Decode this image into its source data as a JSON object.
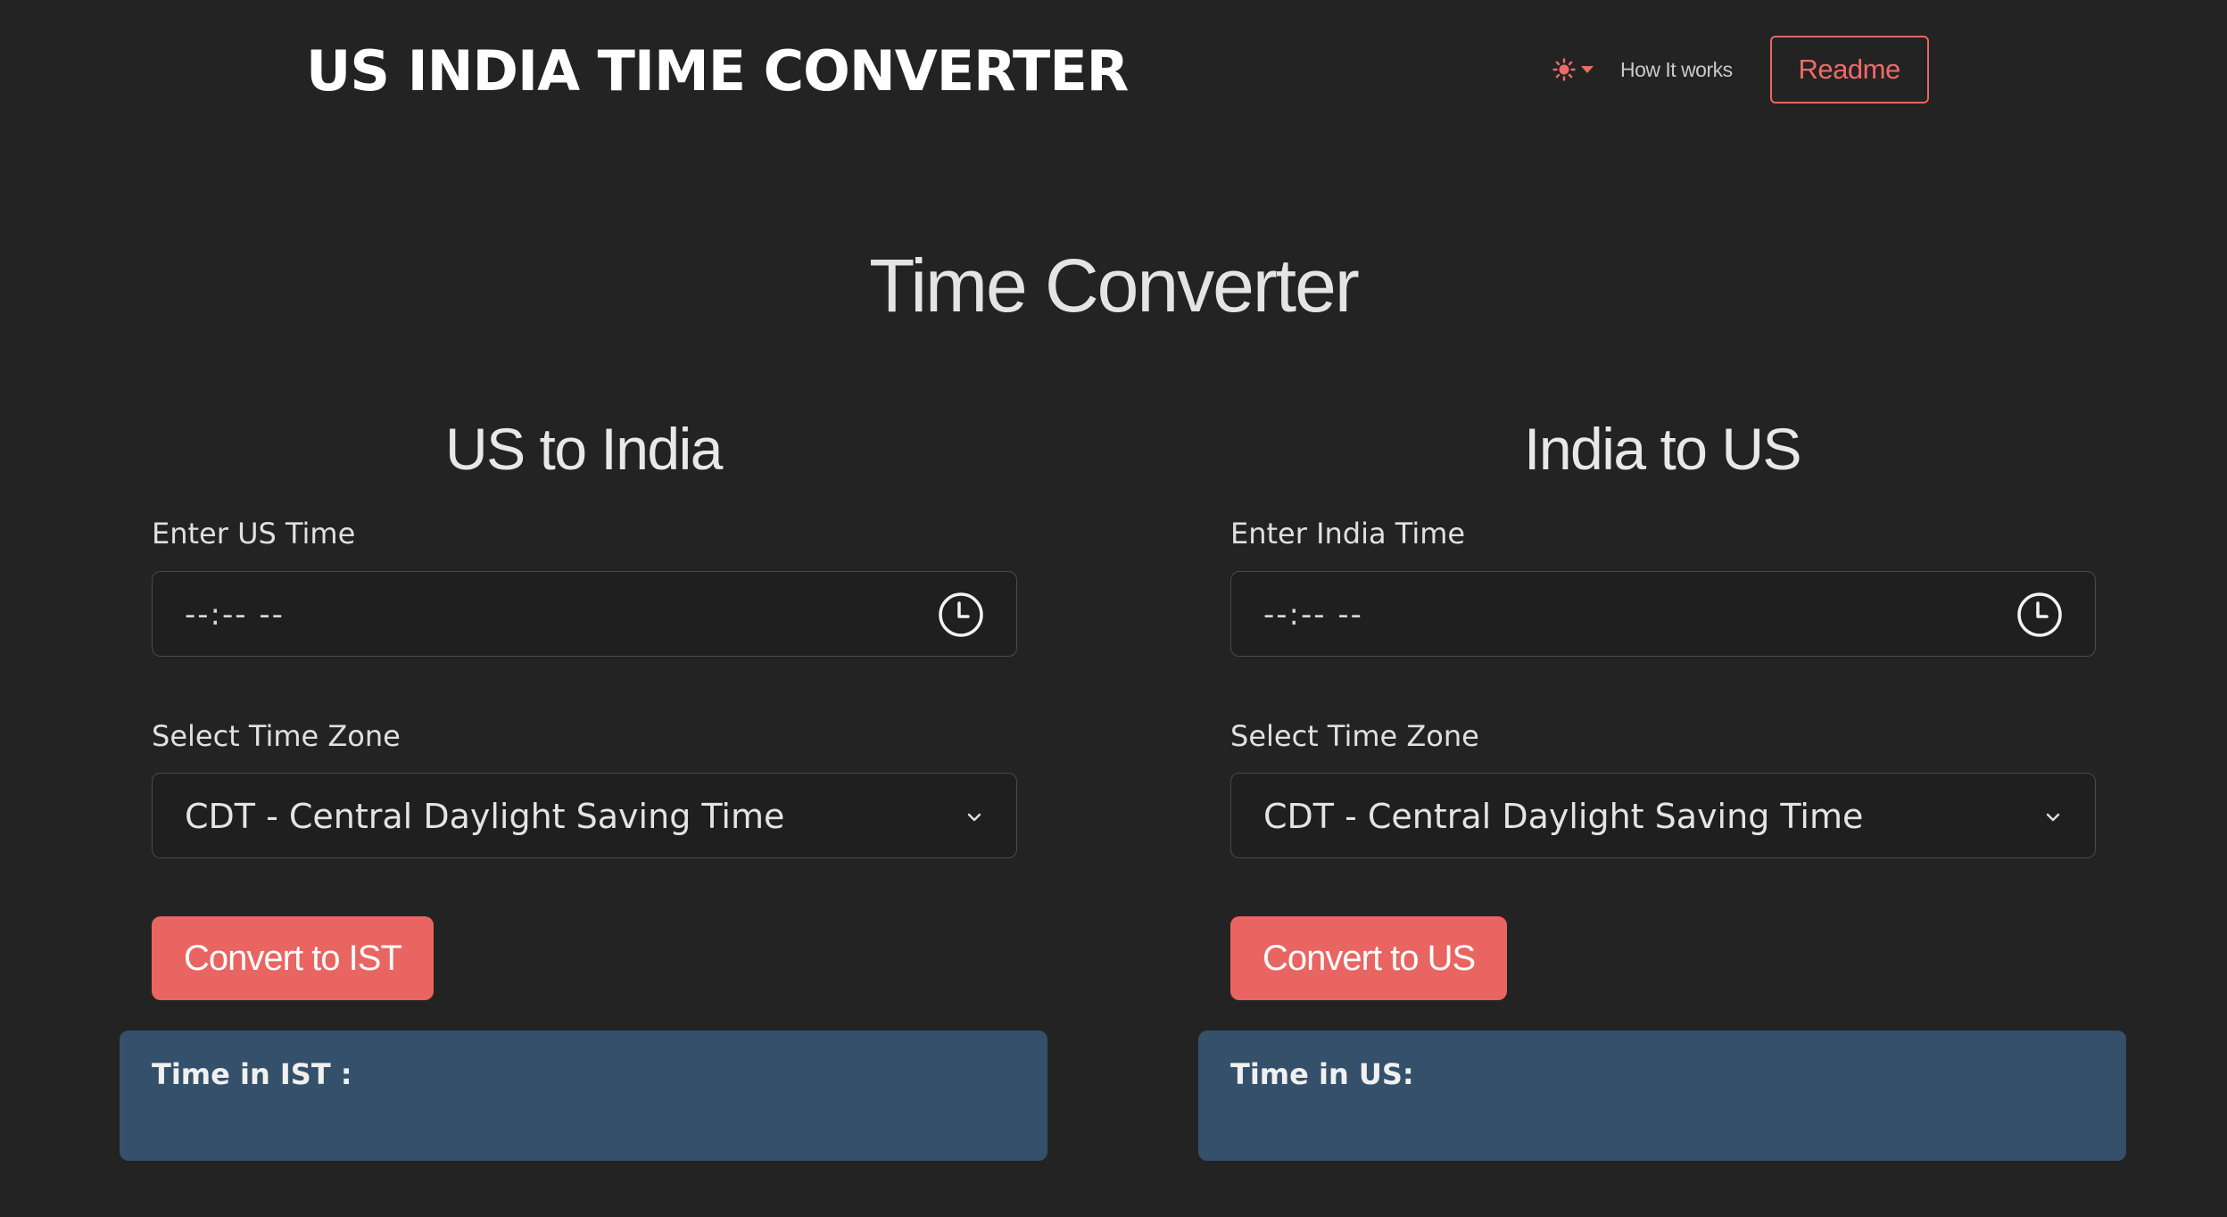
{
  "header": {
    "brand": "US INDIA TIME CONVERTER",
    "how_it_works": "How It works",
    "readme": "Readme",
    "theme_icon": "sun-icon"
  },
  "main": {
    "title": "Time Converter"
  },
  "us_to_india": {
    "title": "US to India",
    "time_label": "Enter US Time",
    "time_value": "--:-- --",
    "tz_label": "Select Time Zone",
    "tz_value": "CDT - Central Daylight Saving Time",
    "button": "Convert to IST",
    "result_label": "Time in IST :"
  },
  "india_to_us": {
    "title": "India to US",
    "time_label": "Enter India Time",
    "time_value": "--:-- --",
    "tz_label": "Select Time Zone",
    "tz_value": "CDT - Central Daylight Saving Time",
    "button": "Convert to US",
    "result_label": "Time in US:"
  },
  "colors": {
    "background": "#232324",
    "accent": "#e96561",
    "result_bg": "#34506a",
    "input_border": "#4a4a4c"
  }
}
